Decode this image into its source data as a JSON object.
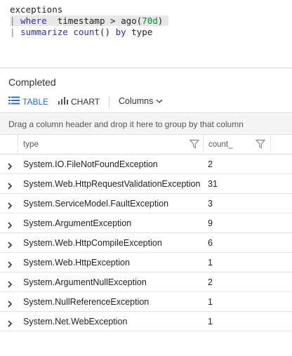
{
  "query": {
    "line1": "exceptions",
    "line2_pipe": "|",
    "line2_kw": "where",
    "line2_text": "  timestamp > ",
    "line2_fn": "ago",
    "line2_open": "(",
    "line2_num": "70d",
    "line2_close": ")",
    "line3_pipe": "|",
    "line3_kw": "summarize",
    "line3_fn": "count",
    "line3_text": "()",
    "line3_by": "by",
    "line3_field": "type"
  },
  "status": "Completed",
  "toolbar": {
    "table_label": "TABLE",
    "chart_label": "CHART",
    "columns_label": "Columns"
  },
  "group_hint": "Drag a column header and drop it here to group by that column",
  "columns": [
    "type",
    "count_"
  ],
  "rows": [
    {
      "type": "System.IO.FileNotFoundException",
      "count": "2"
    },
    {
      "type": "System.Web.HttpRequestValidationException",
      "count": "31"
    },
    {
      "type": "System.ServiceModel.FaultException",
      "count": "3"
    },
    {
      "type": "System.ArgumentException",
      "count": "9"
    },
    {
      "type": "System.Web.HttpCompileException",
      "count": "6"
    },
    {
      "type": "System.Web.HttpException",
      "count": "1"
    },
    {
      "type": "System.ArgumentNullException",
      "count": "2"
    },
    {
      "type": "System.NullReferenceException",
      "count": "1"
    },
    {
      "type": "System.Net.WebException",
      "count": "1"
    }
  ],
  "icons": {
    "table": "table-icon",
    "chart": "bar-chart-icon",
    "columns": "chevron-down-icon",
    "filter": "filter-icon",
    "expand": "chevron-right-icon"
  },
  "colors": {
    "accent": "#1f6fc5",
    "keyword": "#2b2bb8",
    "number": "#0b8a3a"
  }
}
